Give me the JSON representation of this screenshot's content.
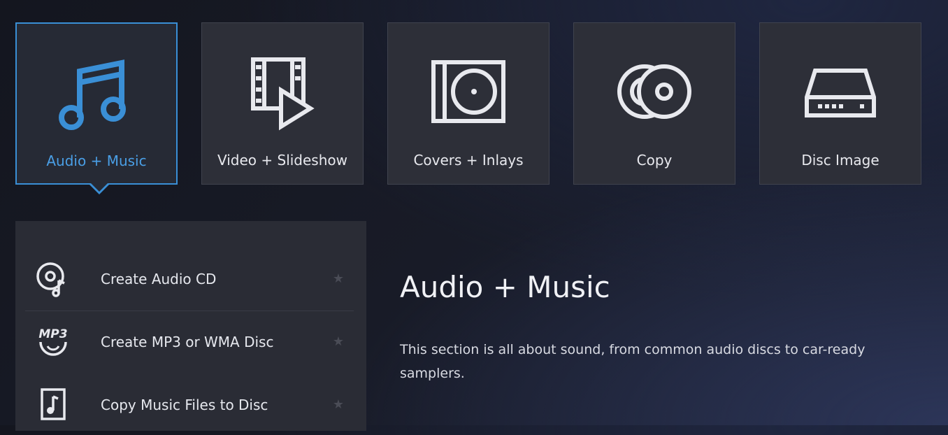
{
  "colors": {
    "accent": "#3a8fd6",
    "tile_bg": "#2d2f38",
    "panel_bg": "#2a2c35"
  },
  "tiles": [
    {
      "label": "Audio + Music",
      "icon": "music-notes-icon",
      "active": true
    },
    {
      "label": "Video + Slideshow",
      "icon": "video-slideshow-icon",
      "active": false
    },
    {
      "label": "Covers + Inlays",
      "icon": "disc-cover-icon",
      "active": false
    },
    {
      "label": "Copy",
      "icon": "copy-discs-icon",
      "active": false
    },
    {
      "label": "Disc Image",
      "icon": "disc-drive-icon",
      "active": false
    }
  ],
  "actions": [
    {
      "label": "Create Audio CD",
      "icon": "audio-cd-icon"
    },
    {
      "label": "Create MP3 or WMA Disc",
      "icon": "mp3-disc-icon",
      "icon_text": "MP3"
    },
    {
      "label": "Copy Music Files to Disc",
      "icon": "music-file-icon"
    }
  ],
  "detail": {
    "title": "Audio + Music",
    "description": "This section is all about sound, from common audio discs to car-ready samplers."
  }
}
